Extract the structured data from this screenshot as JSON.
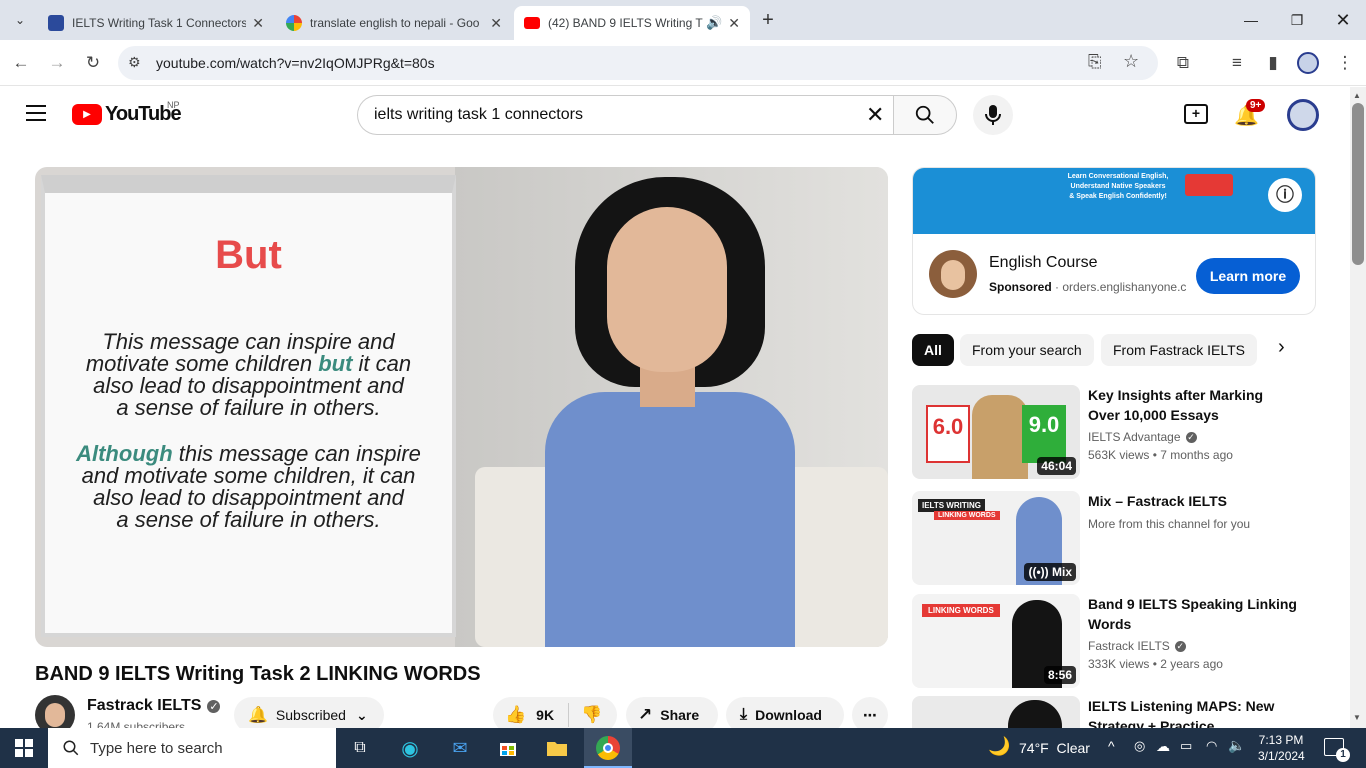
{
  "browser": {
    "tabs": [
      {
        "title": "IELTS Writing Task 1 Connectors",
        "favicon_color": "#2b4a9b"
      },
      {
        "title": "translate english to nepali - Goo",
        "favicon_color": "#4285f4"
      },
      {
        "title": "(42) BAND 9 IELTS Writing T",
        "favicon_color": "#ff0000"
      }
    ],
    "new_tab": "+",
    "url": "youtube.com/watch?v=nv2IqOMJPRg&t=80s"
  },
  "youtube": {
    "logo_text": "YouTube",
    "region": "NP",
    "search_value": "ielts writing task 1 connectors",
    "notification_count": "9+",
    "video": {
      "board_heading": "But",
      "board_para1": [
        "This message can inspire and",
        "motivate some children",
        "but",
        "it can",
        "also lead to disappointment and",
        "a sense of failure in others."
      ],
      "board_para2": [
        "Although",
        "this message can inspire",
        "and motivate some children, it can",
        "also lead to disappointment and",
        "a sense of failure in others."
      ],
      "title": "BAND 9 IELTS Writing Task 2 LINKING WORDS",
      "channel": "Fastrack IELTS",
      "subscribers": "1.64M subscribers",
      "subscribed_label": "Subscribed",
      "likes": "9K",
      "share_label": "Share",
      "download_label": "Download"
    },
    "ad": {
      "banner_lines": [
        "Learn Conversational English,",
        "Understand Native Speakers",
        "& Speak English Confidently!"
      ],
      "title": "English Course",
      "sponsored": "Sponsored",
      "domain": "orders.englishanyone.c",
      "cta": "Learn more"
    },
    "chips": [
      "All",
      "From your search",
      "From Fastrack IELTS"
    ],
    "recommendations": [
      {
        "title": "Key Insights after Marking Over 10,000 Essays",
        "channel": "IELTS Advantage",
        "meta": "563K views • 7 months ago",
        "duration": "46:04",
        "score_left": "6.0",
        "score_right": "9.0"
      },
      {
        "title": "Mix – Fastrack IELTS",
        "channel": "More from this channel for you",
        "meta": "",
        "duration": "Mix",
        "thumb_label": "IELTS WRITING",
        "thumb_sub": "LINKING WORDS"
      },
      {
        "title": "Band 9 IELTS Speaking Linking Words",
        "channel": "Fastrack IELTS",
        "meta": "333K views • 2 years ago",
        "duration": "8:56",
        "thumb_label": "LINKING WORDS"
      },
      {
        "title": "IELTS Listening MAPS: New Strategy + Practice",
        "channel": "",
        "meta": "",
        "duration": ""
      }
    ]
  },
  "taskbar": {
    "search_placeholder": "Type here to search",
    "weather": "74°F  Clear",
    "time": "7:13 PM",
    "date": "3/1/2024",
    "notif_badge": "1"
  }
}
